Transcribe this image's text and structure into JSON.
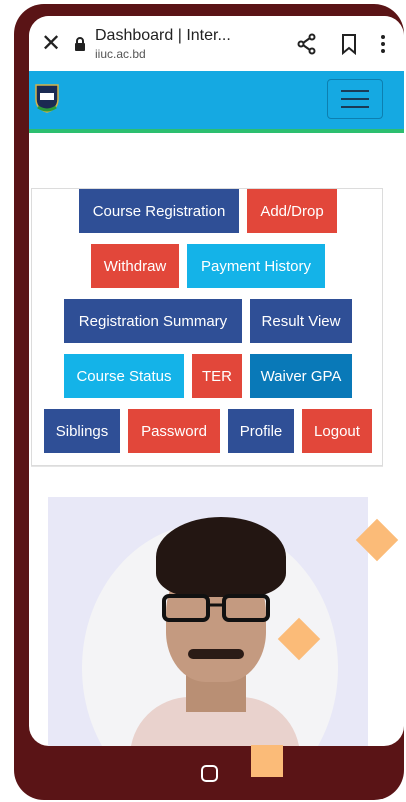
{
  "browser": {
    "page_title": "Dashboard | Inter...",
    "url": "iiuc.ac.bd",
    "close_icon": "close-icon",
    "share_icon": "share-icon",
    "bookmark_icon": "bookmark-icon",
    "menu_icon": "more-vert-icon"
  },
  "navbar": {
    "logo_text": "IIUC",
    "toggler_icon": "hamburger-icon",
    "accent_color": "#15a9e2",
    "underline_color": "#2cbf70"
  },
  "menu": {
    "rows": [
      [
        {
          "label": "Course Registration",
          "color": "#2f4f96"
        },
        {
          "label": "Add/Drop",
          "color": "#e2473a"
        }
      ],
      [
        {
          "label": "Withdraw",
          "color": "#e2473a"
        },
        {
          "label": "Payment History",
          "color": "#14b3e8"
        }
      ],
      [
        {
          "label": "Registration Summary",
          "color": "#2f4f96"
        },
        {
          "label": "Result View",
          "color": "#2f4f96"
        }
      ],
      [
        {
          "label": "Course Status",
          "color": "#14b3e8"
        },
        {
          "label": "TER",
          "color": "#e2473a"
        },
        {
          "label": "Waiver GPA",
          "color": "#0979b8"
        }
      ],
      [
        {
          "label": "Siblings",
          "color": "#2f4f96"
        },
        {
          "label": "Password",
          "color": "#e2473a"
        },
        {
          "label": "Profile",
          "color": "#2f4f96"
        },
        {
          "label": "Logout",
          "color": "#e2473a"
        }
      ]
    ]
  },
  "device": {
    "home_icon": "home-icon"
  }
}
